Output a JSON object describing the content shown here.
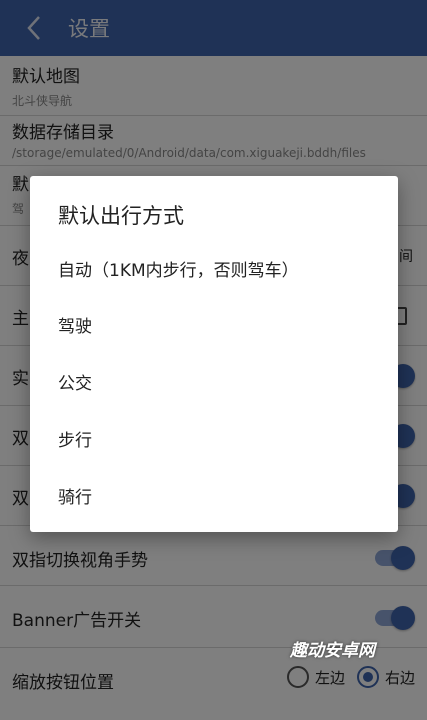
{
  "appbar": {
    "title": "设置",
    "back_icon": "chevron-left-icon"
  },
  "settings": {
    "default_map": {
      "label": "默认地图",
      "value": "北斗侠导航"
    },
    "storage_dir": {
      "label": "数据存储目录",
      "value": "/storage/emulated/0/Android/data/com.xiguakeji.bddh/files"
    },
    "travel_mode": {
      "label_partial": "默",
      "value_partial": "驾"
    },
    "night_mode": {
      "label_partial": "夜",
      "value_partial": "间"
    },
    "row_main": {
      "label_partial": "主"
    },
    "row_realtime": {
      "label_partial": "实"
    },
    "row_double1": {
      "label_partial": "双"
    },
    "row_double2": {
      "label_partial": "双"
    },
    "double_finger_view": {
      "label": "双指切换视角手势"
    },
    "banner_ad": {
      "label": "Banner广告开关"
    },
    "zoom_button_pos": {
      "label": "缩放按钮位置",
      "option_left": "左边",
      "option_right": "右边",
      "selected": "右边"
    }
  },
  "dialog": {
    "title": "默认出行方式",
    "options": [
      "自动（1KM内步行，否则驾车）",
      "驾驶",
      "公交",
      "步行",
      "骑行"
    ]
  },
  "watermark": "趣动安卓网",
  "colors": {
    "primary": "#3f64ad",
    "toggle_track": "#8fa7d6"
  }
}
